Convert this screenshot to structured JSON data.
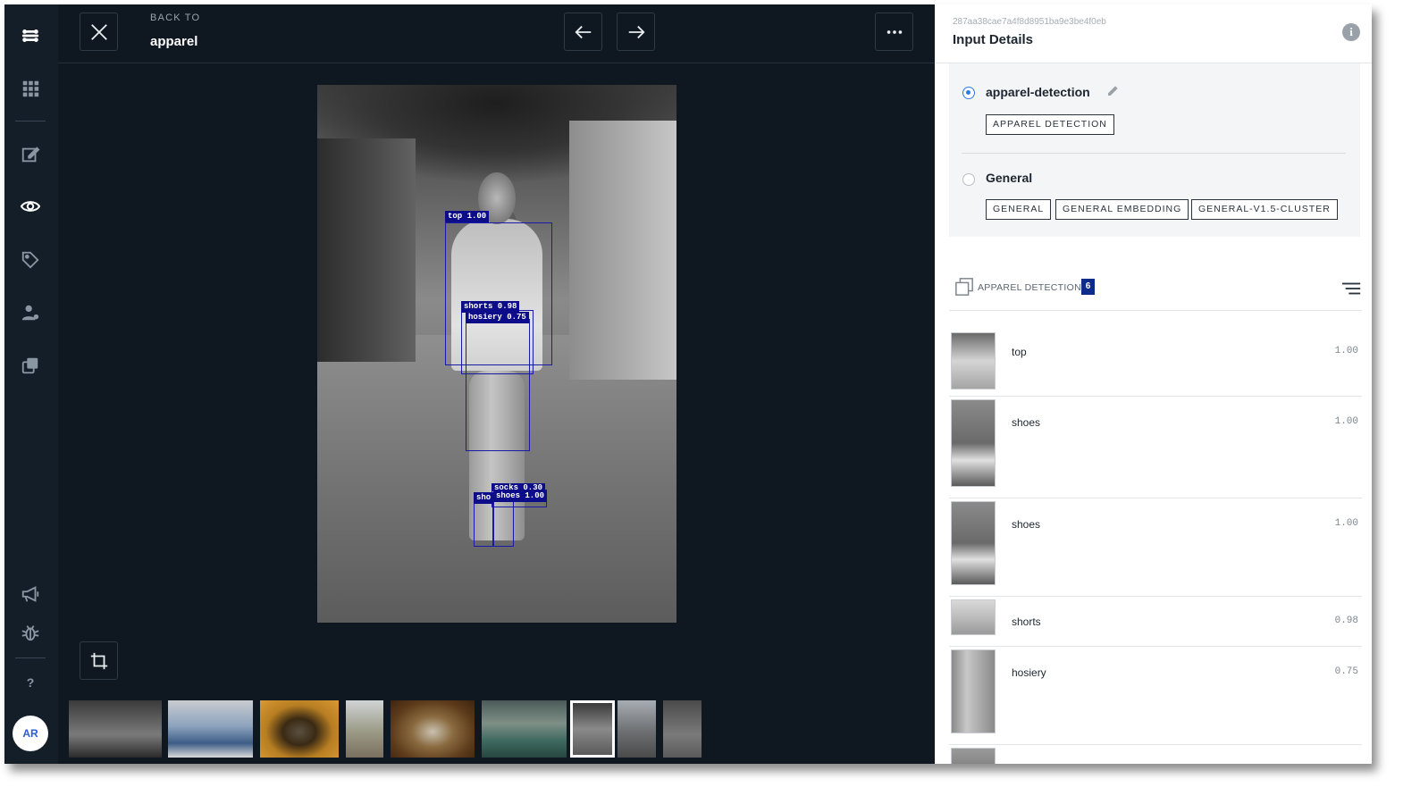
{
  "rail": {
    "avatar": "AR",
    "help": "?"
  },
  "topbar": {
    "back_to": "BACK TO",
    "back_title": "apparel"
  },
  "detections_overlay": [
    {
      "label": "top 1.00"
    },
    {
      "label": "shorts 0.98"
    },
    {
      "label": "hosiery 0.75"
    },
    {
      "label": "socks 0.30"
    },
    {
      "label": "sho"
    },
    {
      "label": "shoes 1.00"
    }
  ],
  "panel": {
    "input_id": "287aa38cae7a4f8d8951ba9e3be4f0eb",
    "title": "Input Details",
    "models": [
      {
        "name": "apparel-detection",
        "selected": true,
        "tags": [
          "APPAREL DETECTION"
        ]
      },
      {
        "name": "General",
        "selected": false,
        "tags": [
          "GENERAL",
          "GENERAL EMBEDDING",
          "GENERAL-V1.5-CLUSTER"
        ]
      }
    ],
    "detection_header": {
      "label": "APPAREL DETECTION",
      "count": "6"
    },
    "detections": [
      {
        "name": "top",
        "value": "1.00"
      },
      {
        "name": "shoes",
        "value": "1.00"
      },
      {
        "name": "shoes",
        "value": "1.00"
      },
      {
        "name": "shorts",
        "value": "0.98"
      },
      {
        "name": "hosiery",
        "value": "0.75"
      }
    ]
  },
  "colors": {
    "app_bg": "#0f1720",
    "accent_blue": "#2e7be6",
    "bbox": "#1a1aa8",
    "badge": "#0d2b8a"
  }
}
